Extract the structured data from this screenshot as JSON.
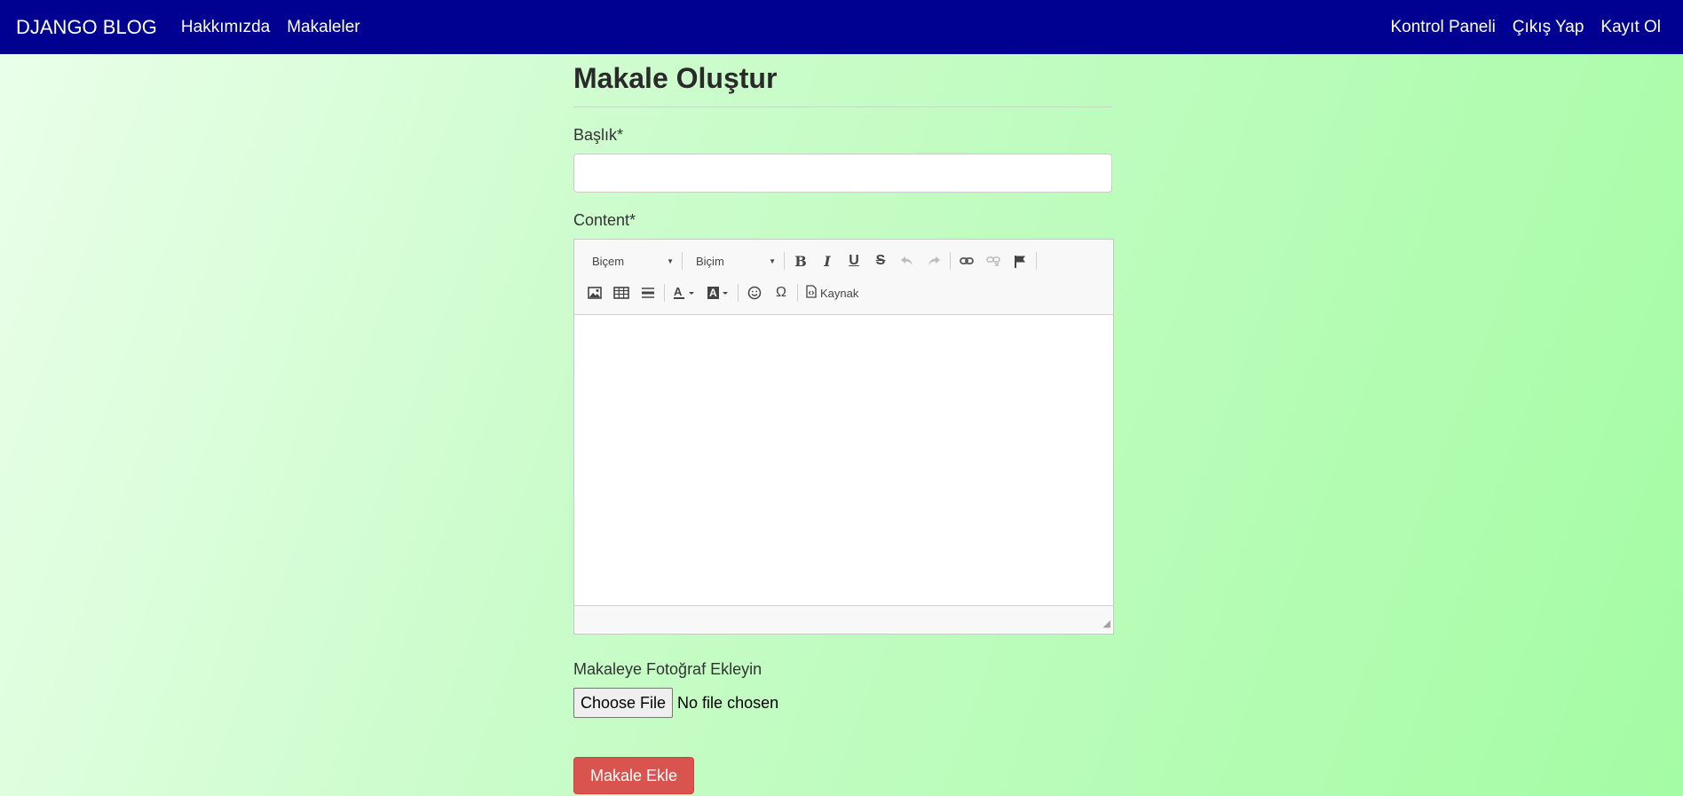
{
  "navbar": {
    "brand": "DJANGO BLOG",
    "left_links": [
      "Hakkımızda",
      "Makaleler"
    ],
    "right_links": [
      "Kontrol Paneli",
      "Çıkış Yap",
      "Kayıt Ol"
    ],
    "background": "#000091"
  },
  "page": {
    "title": "Makale Oluştur"
  },
  "form": {
    "title_label": "Başlık*",
    "title_value": "",
    "content_label": "Content*",
    "editor": {
      "style_combo": "Biçem",
      "format_combo": "Biçim",
      "source_label": "Kaynak"
    },
    "photo_label": "Makaleye Fotoğraf Ekleyin",
    "file_button": "Choose File",
    "file_status": "No file chosen",
    "submit_label": "Makale Ekle",
    "submit_color": "#d9534f"
  }
}
